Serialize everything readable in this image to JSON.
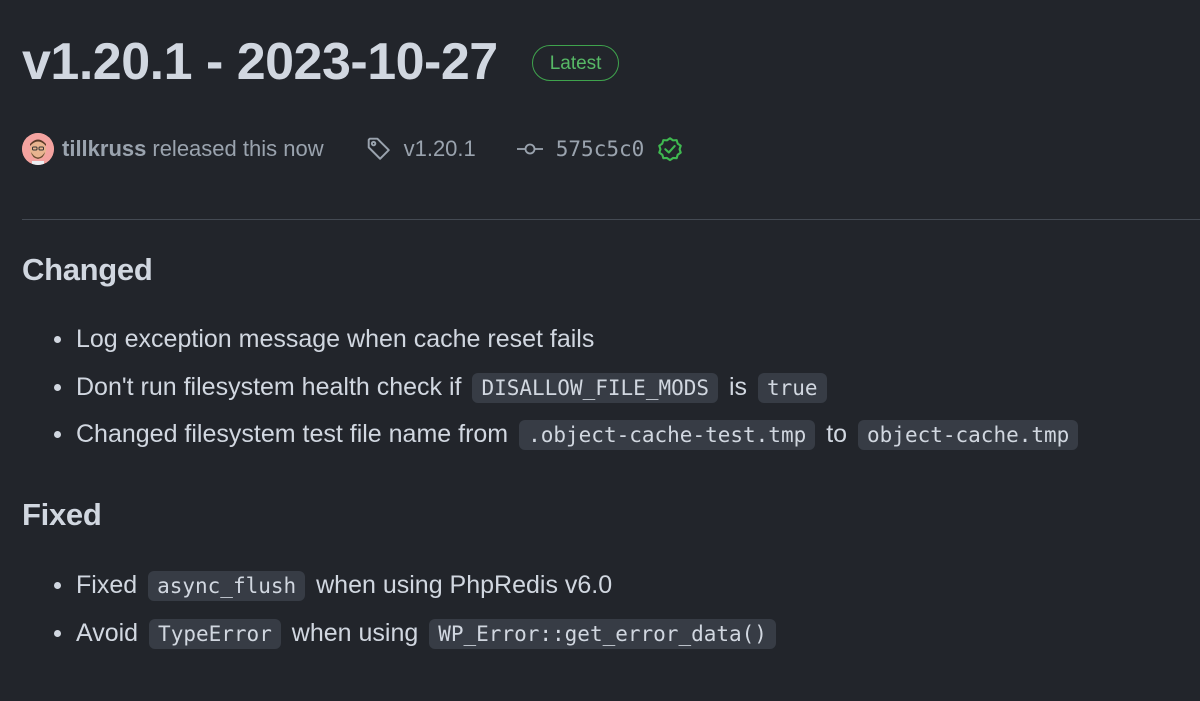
{
  "release": {
    "title": "v1.20.1 - 2023-10-27",
    "badge": "Latest",
    "author": "tillkruss",
    "released_text": "released this now",
    "tag": "v1.20.1",
    "commit": "575c5c0"
  },
  "icons": {
    "tag": "tag-icon",
    "commit": "git-commit-icon",
    "verified": "verified-check-icon",
    "avatar": "user-avatar"
  },
  "colors": {
    "background": "#22252b",
    "text": "#d1d7e0",
    "muted": "#9aa3ae",
    "badge_green": "#3fa34d",
    "code_bg": "#373c45"
  },
  "sections": [
    {
      "heading": "Changed",
      "items": [
        {
          "parts": [
            "Log exception message when cache reset fails"
          ]
        },
        {
          "parts": [
            "Don't run filesystem health check if",
            "DISALLOW_FILE_MODS",
            "is",
            "true"
          ]
        },
        {
          "parts": [
            "Changed filesystem test file name from",
            ".object-cache-test.tmp",
            "to",
            "object-cache.tmp"
          ]
        }
      ]
    },
    {
      "heading": "Fixed",
      "items": [
        {
          "parts": [
            "Fixed",
            "async_flush",
            "when using PhpRedis v6.0"
          ]
        },
        {
          "parts": [
            "Avoid",
            "TypeError",
            "when using",
            "WP_Error::get_error_data()"
          ]
        }
      ]
    }
  ]
}
